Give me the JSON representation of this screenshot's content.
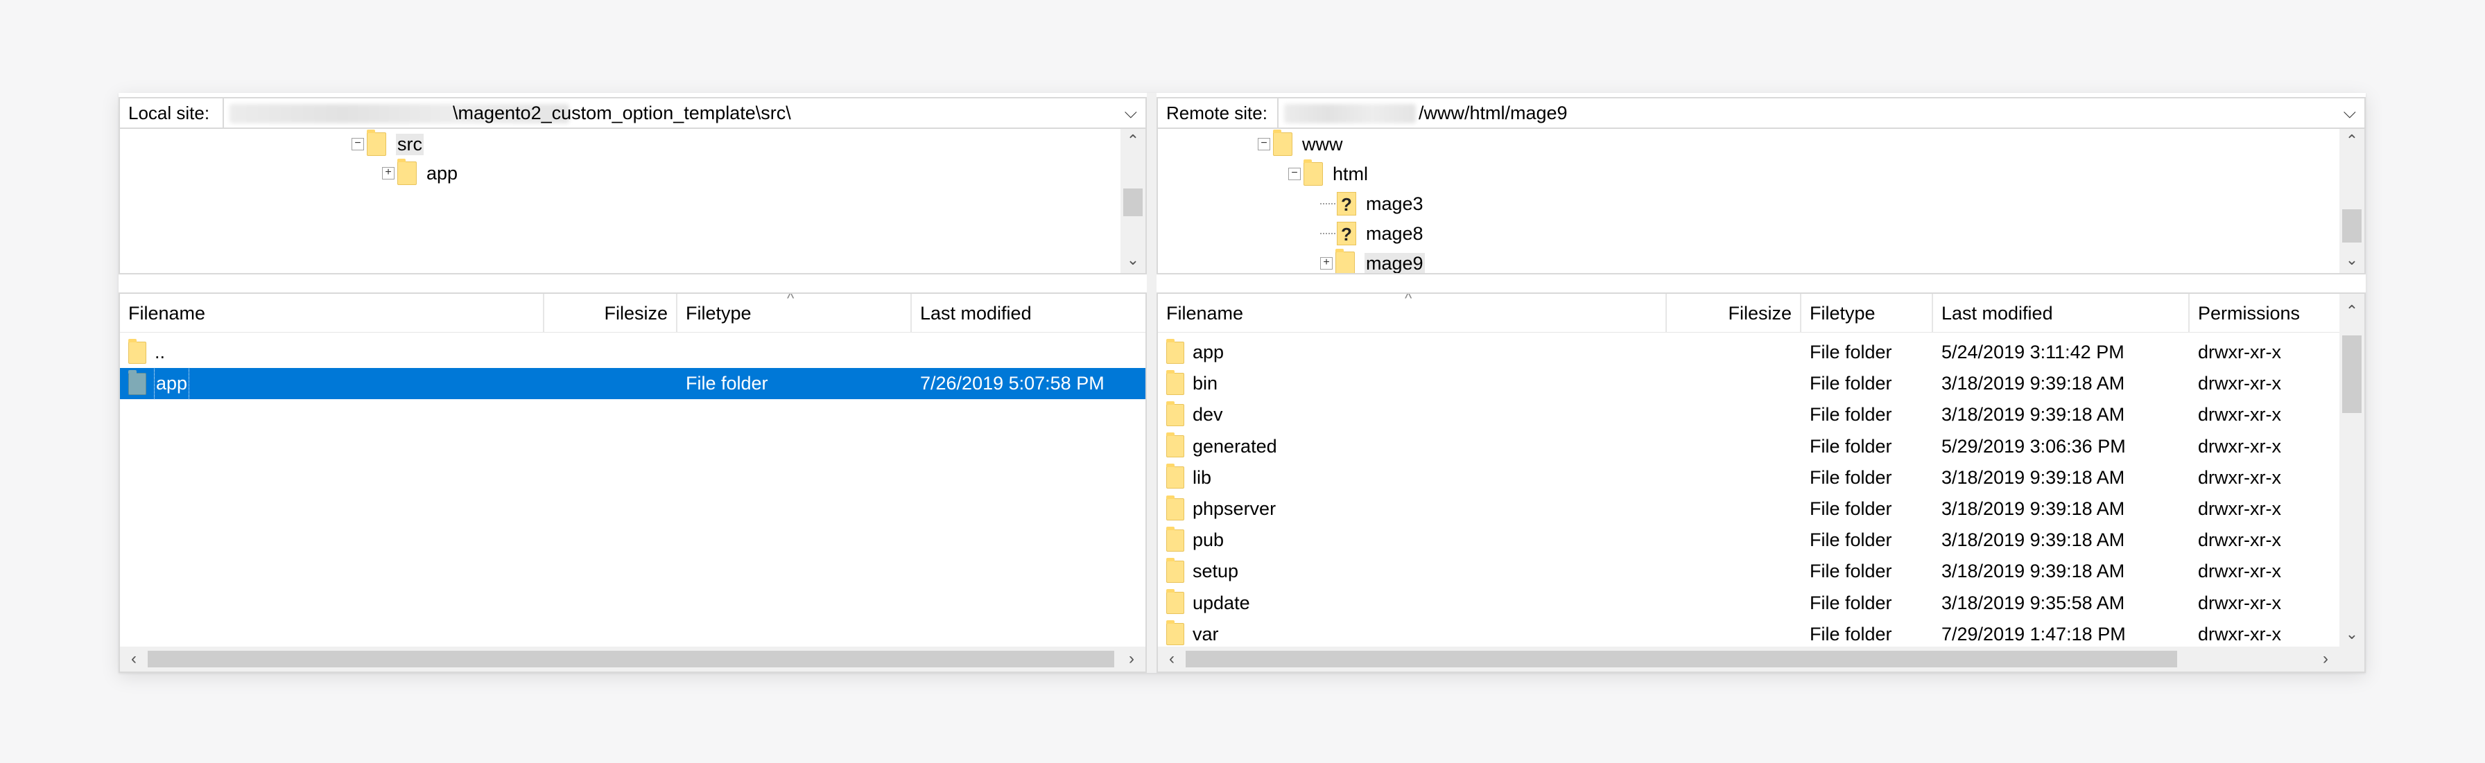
{
  "local": {
    "site_label": "Local site:",
    "site_path": "\\magento2_custom_option_template\\src\\",
    "tree": [
      {
        "label": "src",
        "expander": "−"
      },
      {
        "label": "app",
        "expander": "+"
      }
    ],
    "columns": [
      "Filename",
      "Filesize",
      "Filetype",
      "Last modified"
    ],
    "rows": [
      {
        "name": "..",
        "type": "",
        "modified": ""
      },
      {
        "name": "app",
        "type": "File folder",
        "modified": "7/26/2019 5:07:58 PM"
      }
    ]
  },
  "remote": {
    "site_label": "Remote site:",
    "site_path": "/www/html/mage9",
    "tree": [
      {
        "label": "www",
        "expander": "−"
      },
      {
        "label": "html",
        "expander": "−"
      },
      {
        "label": "mage3",
        "icon": "?"
      },
      {
        "label": "mage8",
        "icon": "?"
      },
      {
        "label": "mage9",
        "expander": "+"
      }
    ],
    "columns": [
      "Filename",
      "Filesize",
      "Filetype",
      "Last modified",
      "Permissions"
    ],
    "rows": [
      {
        "name": "app",
        "type": "File folder",
        "modified": "5/24/2019 3:11:42 PM",
        "perm": "drwxr-xr-x"
      },
      {
        "name": "bin",
        "type": "File folder",
        "modified": "3/18/2019 9:39:18 AM",
        "perm": "drwxr-xr-x"
      },
      {
        "name": "dev",
        "type": "File folder",
        "modified": "3/18/2019 9:39:18 AM",
        "perm": "drwxr-xr-x"
      },
      {
        "name": "generated",
        "type": "File folder",
        "modified": "5/29/2019 3:06:36 PM",
        "perm": "drwxr-xr-x"
      },
      {
        "name": "lib",
        "type": "File folder",
        "modified": "3/18/2019 9:39:18 AM",
        "perm": "drwxr-xr-x"
      },
      {
        "name": "phpserver",
        "type": "File folder",
        "modified": "3/18/2019 9:39:18 AM",
        "perm": "drwxr-xr-x"
      },
      {
        "name": "pub",
        "type": "File folder",
        "modified": "3/18/2019 9:39:18 AM",
        "perm": "drwxr-xr-x"
      },
      {
        "name": "setup",
        "type": "File folder",
        "modified": "3/18/2019 9:39:18 AM",
        "perm": "drwxr-xr-x"
      },
      {
        "name": "update",
        "type": "File folder",
        "modified": "3/18/2019 9:35:58 AM",
        "perm": "drwxr-xr-x"
      },
      {
        "name": "var",
        "type": "File folder",
        "modified": "7/29/2019 1:47:18 PM",
        "perm": "drwxr-xr-x"
      }
    ]
  },
  "icons": {
    "dropdown": "chevron-down-icon",
    "folder": "folder-icon",
    "unknown_folder": "question-folder-icon",
    "scroll_up": "chevron-up-icon",
    "scroll_down": "chevron-down-icon",
    "scroll_left": "chevron-left-icon",
    "scroll_right": "chevron-right-icon"
  },
  "colors": {
    "selection": "#0078d7",
    "folder": "#ffe289",
    "background": "#f6f6f7"
  }
}
